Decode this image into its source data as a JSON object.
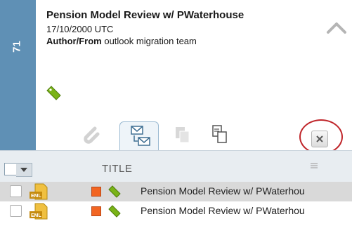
{
  "sidebar": {
    "number": "71"
  },
  "item": {
    "title": "Pension Model Review w/ PWaterhouse",
    "date": "17/10/2000 UTC",
    "author_label": "Author/From",
    "author_value": "outlook migration team"
  },
  "toolbar": {
    "icons": [
      "paperclip-icon",
      "email-thread-icon",
      "copy-icon",
      "paste-icon",
      "close-icon"
    ]
  },
  "list": {
    "column_title": "TITLE",
    "rows": [
      {
        "file_type": "EML",
        "title": "Pension Model Review  w/ PWaterhou"
      },
      {
        "file_type": "EML",
        "title": "Pension Model Review  w/ PWaterhou"
      }
    ]
  },
  "colors": {
    "accent_blue": "#5f90b5",
    "tag_green": "#7ab317",
    "flag_orange": "#f26522",
    "highlight_circle": "#c0262b"
  }
}
